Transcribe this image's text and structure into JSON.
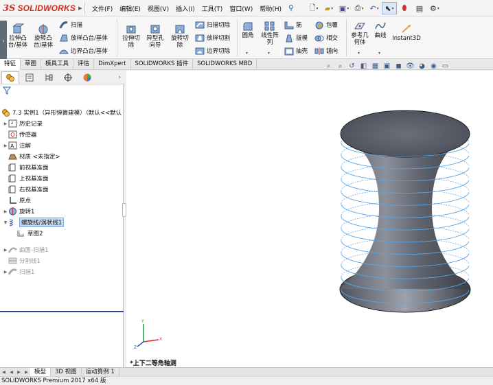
{
  "app": {
    "brand": "SOLIDWORKS",
    "ds_mark": "3S"
  },
  "menu": [
    "文件(F)",
    "编辑(E)",
    "视图(V)",
    "插入(I)",
    "工具(T)",
    "窗口(W)",
    "帮助(H)"
  ],
  "ribbon": {
    "extrude_boss": "拉伸凸\n台/基体",
    "revolve_boss": "旋转凸\n台/基体",
    "sweep": "扫描",
    "loft_boss": "放样凸台/基体",
    "boundary_boss": "边界凸台/基体",
    "extrude_cut": "拉伸切\n除",
    "hole_wizard": "异型孔\n向导",
    "revolve_cut": "旋转切\n除",
    "swept_cut": "扫描切除",
    "lofted_cut": "放样切割",
    "boundary_cut": "边界切除",
    "fillet": "圆角",
    "linear_pattern": "线性阵\n列",
    "rib": "筋",
    "draft": "拔模",
    "shell": "抽壳",
    "wrap": "包覆",
    "intersect": "相交",
    "mirror": "镜向",
    "ref_geometry": "参考几\n何体",
    "curves": "曲线",
    "instant3d": "Instant3D"
  },
  "tabs": [
    "特征",
    "草图",
    "模具工具",
    "评估",
    "DimXpert",
    "SOLIDWORKS 插件",
    "SOLIDWORKS MBD"
  ],
  "tree": {
    "root": "7.3 实例1（异形弹簧建模）（默认<<默认",
    "items": [
      {
        "label": "历史记录",
        "icon": "history-icon"
      },
      {
        "label": "传感器",
        "icon": "sensor-icon"
      },
      {
        "label": "注解",
        "icon": "annotation-icon"
      },
      {
        "label": "材质 <未指定>",
        "icon": "material-icon"
      },
      {
        "label": "前视基准面",
        "icon": "plane-icon"
      },
      {
        "label": "上视基准面",
        "icon": "plane-icon"
      },
      {
        "label": "右视基准面",
        "icon": "plane-icon"
      },
      {
        "label": "原点",
        "icon": "origin-icon"
      },
      {
        "label": "旋转1",
        "icon": "revolve-icon"
      },
      {
        "label": "螺旋线/涡状线1",
        "icon": "helix-icon"
      },
      {
        "label": "草图2",
        "icon": "sketch-icon"
      },
      {
        "label": "曲面-扫描1",
        "icon": "surface-icon"
      },
      {
        "label": "分割线1",
        "icon": "split-line-icon"
      },
      {
        "label": "扫描1",
        "icon": "sweep-icon"
      }
    ]
  },
  "view": {
    "orientation_label": "*上下二等角轴测"
  },
  "bottom_tabs": [
    "模型",
    "3D 视图",
    "运动算例 1"
  ],
  "status": {
    "text": "SOLIDWORKS Premium 2017 x64 版"
  },
  "colors": {
    "brand_red": "#d52b1e",
    "helix_blue": "#58a6e8",
    "body_dark": "#4b4f5a"
  }
}
